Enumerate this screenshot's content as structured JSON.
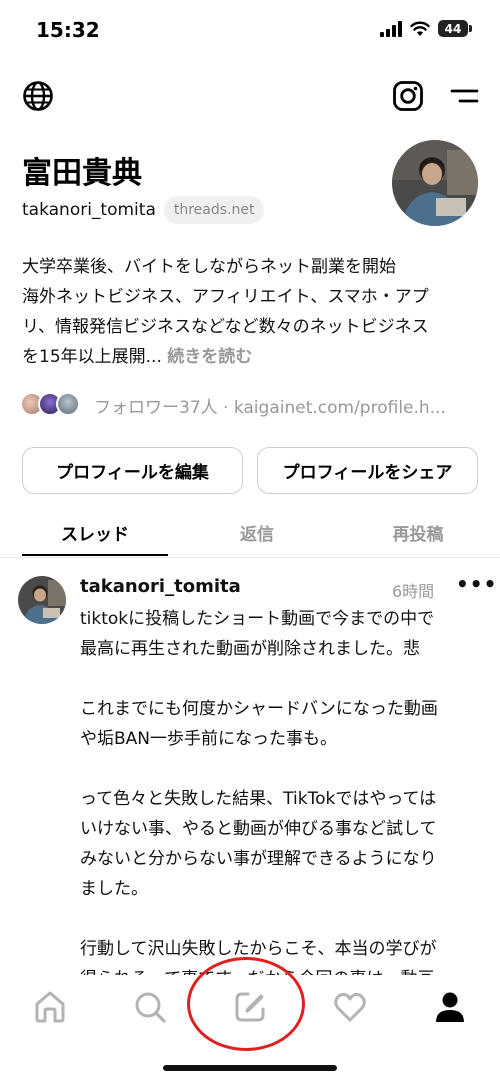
{
  "status_bar": {
    "time": "15:32",
    "battery": "44",
    "icons": [
      "signal-icon",
      "wifi-icon",
      "battery-icon"
    ]
  },
  "top_nav": {
    "icons": [
      "globe-icon",
      "instagram-icon",
      "menu-icon"
    ]
  },
  "profile": {
    "name": "富田貴典",
    "handle": "takanori_tomita",
    "domain": "threads.net",
    "bio_lines": [
      "大学卒業後、バイトをしながらネット副業を開始",
      "海外ネットビジネス、アフィリエイト、スマホ・アプ",
      "リ、情報発信ビジネスなどなど数々のネットビジネス",
      "を15年以上展開..."
    ],
    "bio_more": "続きを読む",
    "followers_text": "フォロワー37人 · kaigainet.com/profile.h..."
  },
  "buttons": {
    "edit": "プロフィールを編集",
    "share": "プロフィールをシェア"
  },
  "tabs": [
    {
      "label": "スレッド",
      "active": true
    },
    {
      "label": "返信",
      "active": false
    },
    {
      "label": "再投稿",
      "active": false
    }
  ],
  "post": {
    "username": "takanori_tomita",
    "time": "6時間",
    "more": "•••",
    "paragraphs": [
      [
        "tiktokに投稿したショート動画で今までの中で",
        "最高に再生された動画が削除されました。悲"
      ],
      [
        "これまでにも何度かシャードバンになった動画",
        "や垢BAN一歩手前になった事も。"
      ],
      [
        "って色々と失敗した結果、TikTokではやっては",
        "いけない事、やると動画が伸びる事など試して",
        "みないと分からない事が理解できるようになり",
        "ました。"
      ],
      [
        "行動して沢山失敗したからこそ、本当の学びが",
        "得られるって事です。だから今回の事は、動画"
      ]
    ]
  },
  "bottom_nav": {
    "items": [
      "home-icon",
      "search-icon",
      "compose-icon",
      "heart-icon",
      "profile-icon"
    ],
    "active": "profile-icon"
  },
  "colors": {
    "highlight": "#e02020",
    "muted": "#999999",
    "text": "#111111"
  }
}
